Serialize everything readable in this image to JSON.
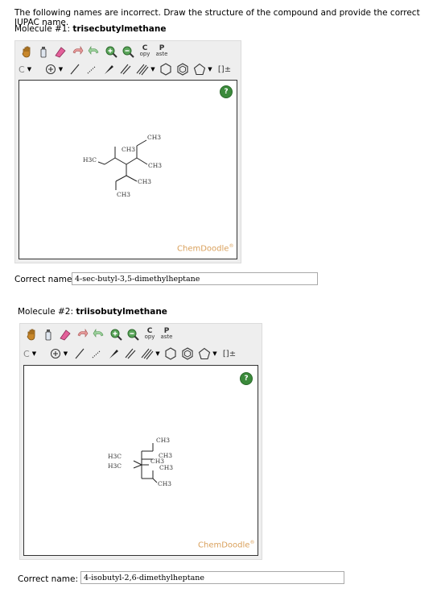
{
  "instructions": "The following names are incorrect. Draw the structure of the compound and provide the correct IUPAC name.",
  "toolbar": {
    "copy_label_top": "C",
    "copy_label_bottom": "opy",
    "paste_label_top": "P",
    "paste_label_bottom": "aste",
    "element_label": "C",
    "bracket_label": "[]±"
  },
  "molecules": [
    {
      "title_prefix": "Molecule #1: ",
      "title_name": "trisecbutylmethane",
      "watermark": "ChemDoodle",
      "watermark_mark": "®",
      "answer_label": "Correct name:",
      "answer_value": "4-sec-butyl-3,5-dimethylheptane",
      "atom_labels": {
        "l1": "CH3",
        "l2": "H3C",
        "l3": "CH3",
        "l4": "CH3",
        "l5": "CH3",
        "l6": "CH3"
      }
    },
    {
      "title_prefix": "Molecule #2: ",
      "title_name": "triisobutylmethane",
      "watermark": "ChemDoodle",
      "watermark_mark": "®",
      "answer_label": "Correct name:",
      "answer_value": "4-isobutyl-2,6-dimethylheptane",
      "atom_labels": {
        "l1": "CH3",
        "l2": "H3C",
        "l3": "H3C",
        "l4": "CH3",
        "l5": "CH3",
        "l6": "CH3",
        "l7": "CH3"
      }
    }
  ],
  "help_label": "?"
}
